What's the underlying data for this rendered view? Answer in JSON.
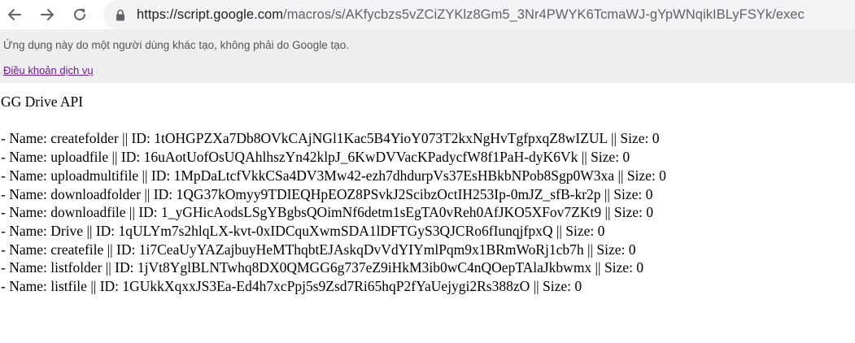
{
  "browser": {
    "url_host": "https://script.google.com",
    "url_path": "/macros/s/AKfycbzs5vZCiZYKlz8Gm5_3Nr4PWYK6TcmaWJ-gYpWNqikIBLyFSYk/exec",
    "icons": {
      "back": "arrow-left-icon",
      "forward": "arrow-right-icon",
      "reload": "reload-icon",
      "lock": "lock-icon"
    },
    "colors": {
      "omnibox_bg": "#f1f3f4",
      "icon": "#5f6368"
    }
  },
  "banner": {
    "notice": "Ứng dụng này do một người dùng khác tạo, không phải do Google tạo.",
    "terms_link": "Điều khoản dịch vụ",
    "colors": {
      "background": "#eeeeee",
      "link": "#6a1b9a"
    }
  },
  "page": {
    "title": "GG Drive API",
    "files": [
      "- Name: createfolder || ID: 1tOHGPZXa7Db8OVkCAjNGl1Kac5B4YioY073T2kxNgHvTgfpxqZ8wIZUL || Size: 0",
      "- Name: uploadfile || ID: 16uAotUofOsUQAhlhszYn42klpJ_6KwDVVacKPadycfW8f1PaH-dyK6Vk || Size: 0",
      "- Name: uploadmultifile || ID: 1MpDaLtcfVkkCSa4DV3Mw42-ezh7dhdurpVs37EsHBkbNPob8Sgp0W3xa || Size: 0",
      "- Name: downloadfolder || ID: 1QG37kOmyy9TDIEQHpEOZ8PSvkJ2ScibzOctIH253Ip-0mJZ_sfB-kr2p || Size: 0",
      "- Name: downloadfile || ID: 1_yGHicAodsLSgYBgbsQOimNf6detm1sEgTA0vReh0AfJKO5XFov7ZKt9 || Size: 0",
      "- Name: Drive || ID: 1qULYm7s2hlqLX-kvt-0xIDCquXwmSDA1lDFTGyS3QJCRo6fIunqjfpxQ || Size: 0",
      "- Name: createfile || ID: 1i7CeaUyYAZajbuyHeMThqbtEJAskqDvVdYIYmlPqm9x1BRmWoRj1cb7h || Size: 0",
      "- Name: listfolder || ID: 1jVt8YglBLNTwhq8DX0QMGG6g737eZ9iHkM3ib0wC4nQOepTAlaJkbwmx || Size: 0",
      "- Name: listfile || ID: 1GUkkXqxxJS3Ea-Ed4h7xcPpj5s9Zsd7Ri65hqP2fYaUejygi2Rs388zO || Size: 0"
    ]
  }
}
